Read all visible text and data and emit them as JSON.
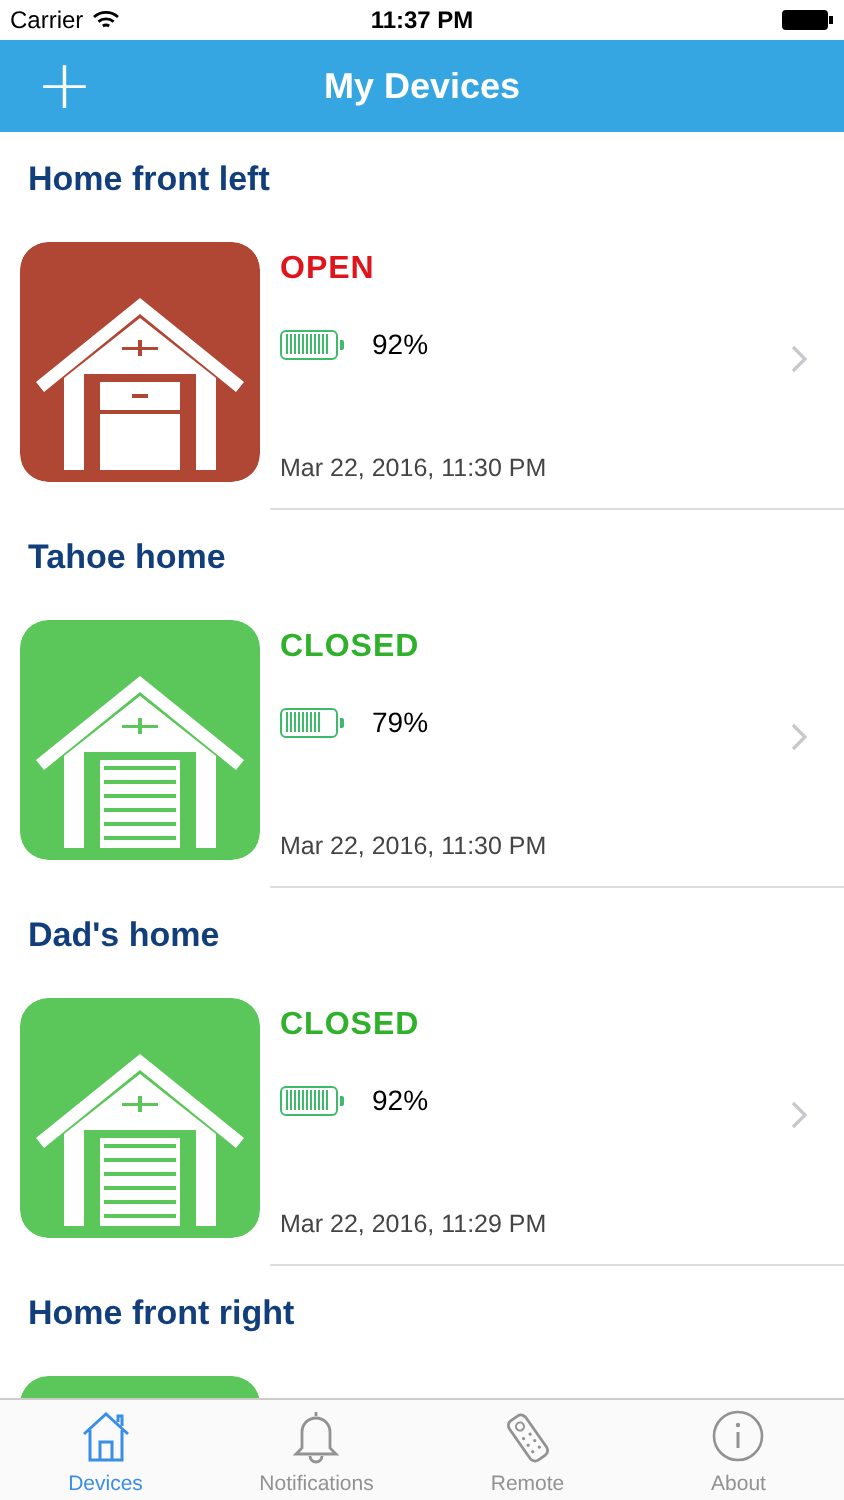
{
  "status_bar": {
    "carrier": "Carrier",
    "time": "11:37 PM"
  },
  "nav_bar": {
    "add": "+",
    "title": "My Devices"
  },
  "devices": [
    {
      "name": "Home front left",
      "open": true,
      "status": "OPEN",
      "battery": {
        "level": 0.92
      },
      "reading": "92%",
      "updated": "Mar 22, 2016, 11:30 PM"
    },
    {
      "name": "Tahoe home",
      "open": false,
      "status": "CLOSED",
      "battery": {
        "level": 0.79
      },
      "reading": "79%",
      "updated": "Mar 22, 2016, 11:30 PM"
    },
    {
      "name": "Dad's home",
      "open": false,
      "status": "CLOSED",
      "battery": {
        "level": 0.92
      },
      "reading": "92%",
      "updated": "Mar 22, 2016, 11:29 PM"
    },
    {
      "name": "Home front right",
      "open": false
    }
  ],
  "tabs": [
    {
      "label": "Devices",
      "kind": "house",
      "selected": true
    },
    {
      "label": "Notifications",
      "kind": "bell",
      "selected": false
    },
    {
      "label": "Remote",
      "kind": "remote",
      "selected": false
    },
    {
      "label": "About",
      "kind": "info",
      "selected": false
    }
  ]
}
